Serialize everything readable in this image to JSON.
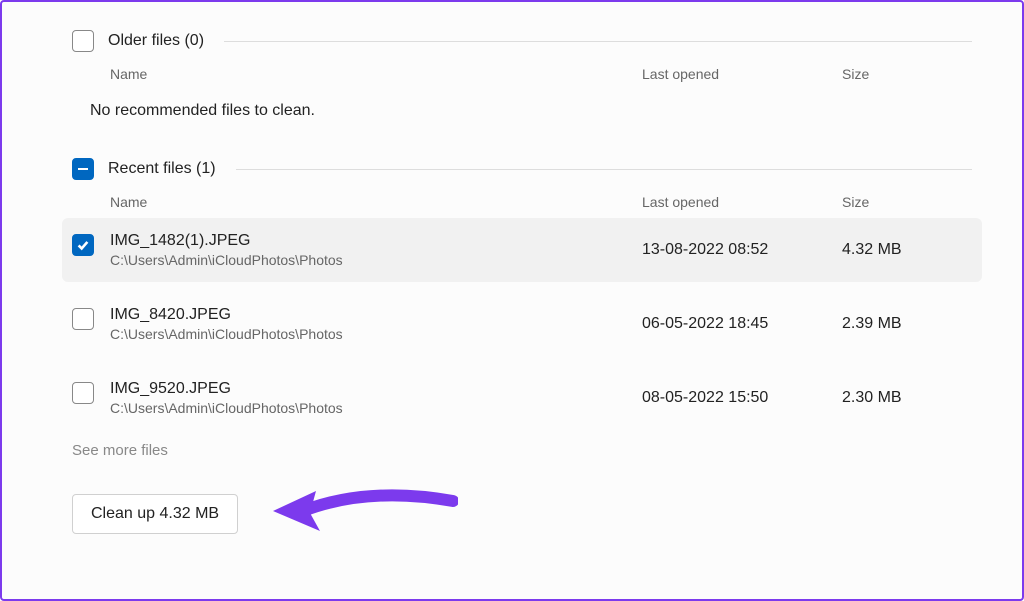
{
  "older": {
    "title": "Older files (0)",
    "cols": {
      "name": "Name",
      "last_opened": "Last opened",
      "size": "Size"
    },
    "empty_msg": "No recommended files to clean."
  },
  "recent": {
    "title": "Recent files (1)",
    "cols": {
      "name": "Name",
      "last_opened": "Last opened",
      "size": "Size"
    },
    "files": [
      {
        "name": "IMG_1482(1).JPEG",
        "path": "C:\\Users\\Admin\\iCloudPhotos\\Photos",
        "last_opened": "13-08-2022 08:52",
        "size": "4.32 MB",
        "checked": true
      },
      {
        "name": "IMG_8420.JPEG",
        "path": "C:\\Users\\Admin\\iCloudPhotos\\Photos",
        "last_opened": "06-05-2022 18:45",
        "size": "2.39 MB",
        "checked": false
      },
      {
        "name": "IMG_9520.JPEG",
        "path": "C:\\Users\\Admin\\iCloudPhotos\\Photos",
        "last_opened": "08-05-2022 15:50",
        "size": "2.30 MB",
        "checked": false
      }
    ]
  },
  "see_more": "See more files",
  "clean_button": "Clean up 4.32 MB"
}
